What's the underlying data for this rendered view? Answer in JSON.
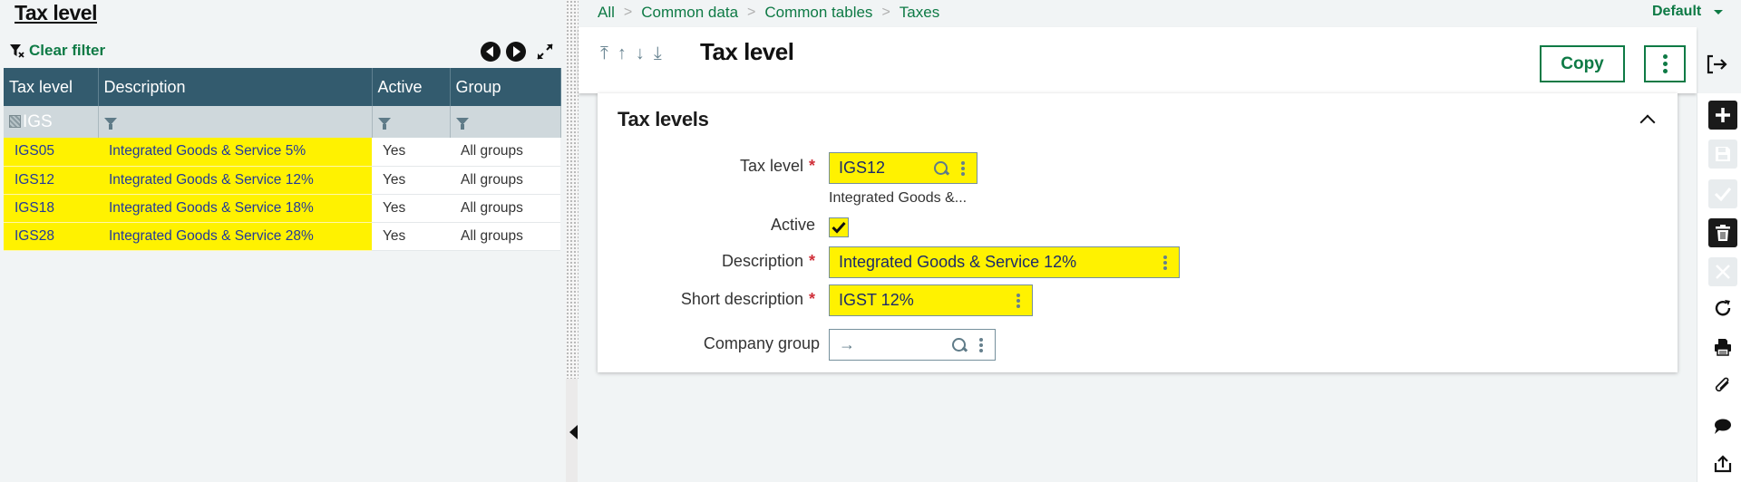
{
  "left_panel": {
    "title": "Tax level",
    "clear_filter_label": "Clear filter",
    "grid": {
      "columns": [
        "Tax level",
        "Description",
        "Active",
        "Group"
      ],
      "filter_values": [
        "IGS",
        "",
        "",
        ""
      ],
      "rows": [
        {
          "tax_level": "IGS05",
          "description": "Integrated Goods & Service 5%",
          "active": "Yes",
          "group": "All groups"
        },
        {
          "tax_level": "IGS12",
          "description": "Integrated Goods & Service 12%",
          "active": "Yes",
          "group": "All groups"
        },
        {
          "tax_level": "IGS18",
          "description": "Integrated Goods & Service 18%",
          "active": "Yes",
          "group": "All groups"
        },
        {
          "tax_level": "IGS28",
          "description": "Integrated Goods & Service 28%",
          "active": "Yes",
          "group": "All groups"
        }
      ]
    }
  },
  "breadcrumb": {
    "items": [
      "All",
      "Common data",
      "Common tables",
      "Taxes"
    ],
    "separator": ">"
  },
  "top_right": {
    "default_label": "Default"
  },
  "header": {
    "record_nav": [
      "⤒",
      "↑",
      "↓",
      "⤓"
    ],
    "title": "Tax level",
    "copy_label": "Copy"
  },
  "form": {
    "section_title": "Tax levels",
    "fields": {
      "tax_level": {
        "label": "Tax level",
        "required": "*",
        "value": "IGS12",
        "subtext": "Integrated Goods &..."
      },
      "active": {
        "label": "Active",
        "checked": true
      },
      "description": {
        "label": "Description",
        "required": "*",
        "value": "Integrated Goods & Service 12%"
      },
      "short_description": {
        "label": "Short description",
        "required": "*",
        "value": "IGST 12%"
      },
      "company_group": {
        "label": "Company group",
        "value": "→"
      }
    }
  },
  "sidebar": {
    "actions": [
      {
        "name": "create",
        "icon": "plus-icon",
        "enabled": true
      },
      {
        "name": "save",
        "icon": "save-icon",
        "enabled": false
      },
      {
        "name": "validate",
        "icon": "check-icon",
        "enabled": false
      },
      {
        "name": "delete",
        "icon": "trash-icon",
        "enabled": true
      },
      {
        "name": "cancel",
        "icon": "close-icon",
        "enabled": false
      },
      {
        "name": "refresh",
        "icon": "refresh-icon",
        "enabled": true
      },
      {
        "name": "print",
        "icon": "print-icon",
        "enabled": true
      },
      {
        "name": "attachments",
        "icon": "paperclip-icon",
        "enabled": true
      },
      {
        "name": "comments",
        "icon": "comment-icon",
        "enabled": true
      },
      {
        "name": "export",
        "icon": "export-icon",
        "enabled": true
      }
    ]
  },
  "colors": {
    "accent": "#0e7a45",
    "grid_header": "#335b6e",
    "highlight": "#fff200",
    "required": "#d0303a"
  }
}
